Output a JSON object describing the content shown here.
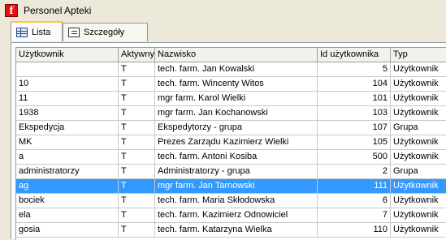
{
  "window": {
    "title": "Personel Apteki",
    "icon": "app-logo-icon"
  },
  "tabs": [
    {
      "label": "Lista",
      "icon": "grid-icon",
      "active": true
    },
    {
      "label": "Szczegóły",
      "icon": "form-icon",
      "active": false
    }
  ],
  "table": {
    "columns": [
      "Użytkownik",
      "Aktywny",
      "Nazwisko",
      "Id użytkownika",
      "Typ"
    ],
    "rows": [
      [
        "",
        "T",
        "tech. farm. Jan Kowalski",
        "5",
        "Użytkownik"
      ],
      [
        "10",
        "T",
        "tech. farm. Wincenty Witos",
        "104",
        "Użytkownik"
      ],
      [
        "11",
        "T",
        "mgr farm. Karol Wielki",
        "101",
        "Użytkownik"
      ],
      [
        "1938",
        "T",
        "mgr farm. Jan Kochanowski",
        "103",
        "Użytkownik"
      ],
      [
        "Ekspedycja",
        "T",
        "Ekspedytorzy - grupa",
        "107",
        "Grupa"
      ],
      [
        "MK",
        "T",
        "Prezes Zarządu Kazimierz Wielki",
        "105",
        "Użytkownik"
      ],
      [
        "a",
        "T",
        "tech. farm. Antoni Kosiba",
        "500",
        "Użytkownik"
      ],
      [
        "administratorzy",
        "T",
        "Administratorzy - grupa",
        "2",
        "Grupa"
      ],
      [
        "ag",
        "T",
        "mgr farm. Jan Tarnowski",
        "111",
        "Użytkownik"
      ],
      [
        "bociek",
        "T",
        "tech. farm. Maria Skłodowska",
        "6",
        "Użytkownik"
      ],
      [
        "ela",
        "T",
        "tech. farm. Kazimierz Odnowiciel",
        "7",
        "Użytkownik"
      ],
      [
        "gosia",
        "T",
        "tech. farm. Katarzyna Wielka",
        "110",
        "Użytkownik"
      ]
    ],
    "selected_row": 8
  },
  "colors": {
    "selection": "#3399ff",
    "tab_accent": "#ffc83c"
  }
}
